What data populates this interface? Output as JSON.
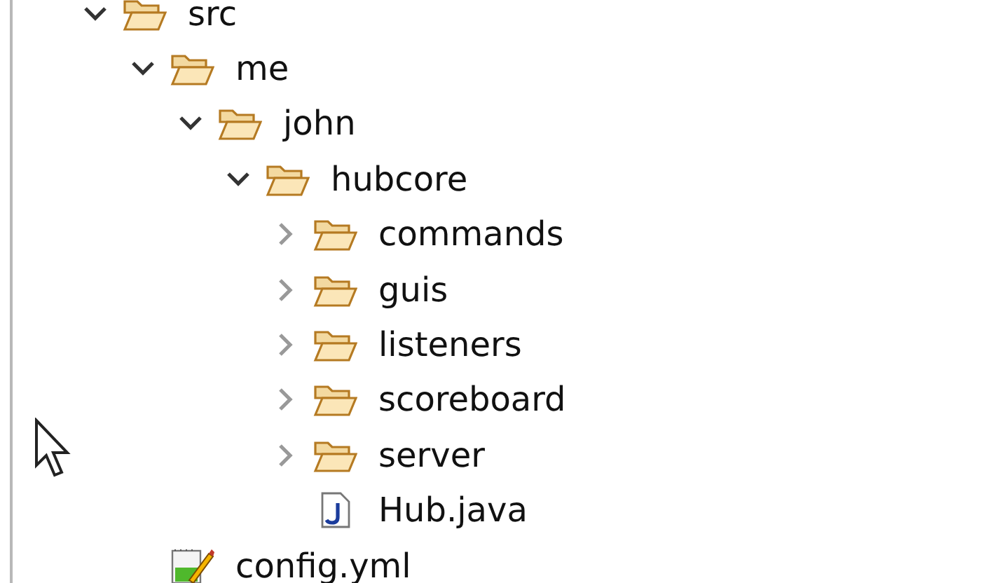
{
  "tree": [
    {
      "name": "src",
      "kind": "folder",
      "expanded": true,
      "children": [
        {
          "name": "me",
          "kind": "folder",
          "expanded": true,
          "children": [
            {
              "name": "john",
              "kind": "folder",
              "expanded": true,
              "children": [
                {
                  "name": "hubcore",
                  "kind": "folder",
                  "expanded": true,
                  "children": [
                    {
                      "name": "commands",
                      "kind": "folder",
                      "expanded": false
                    },
                    {
                      "name": "guis",
                      "kind": "folder",
                      "expanded": false
                    },
                    {
                      "name": "listeners",
                      "kind": "folder",
                      "expanded": false
                    },
                    {
                      "name": "scoreboard",
                      "kind": "folder",
                      "expanded": false
                    },
                    {
                      "name": "server",
                      "kind": "folder",
                      "expanded": false
                    },
                    {
                      "name": "Hub.java",
                      "kind": "java"
                    }
                  ]
                }
              ]
            }
          ]
        },
        {
          "name": "config.yml",
          "kind": "yml"
        }
      ]
    }
  ]
}
